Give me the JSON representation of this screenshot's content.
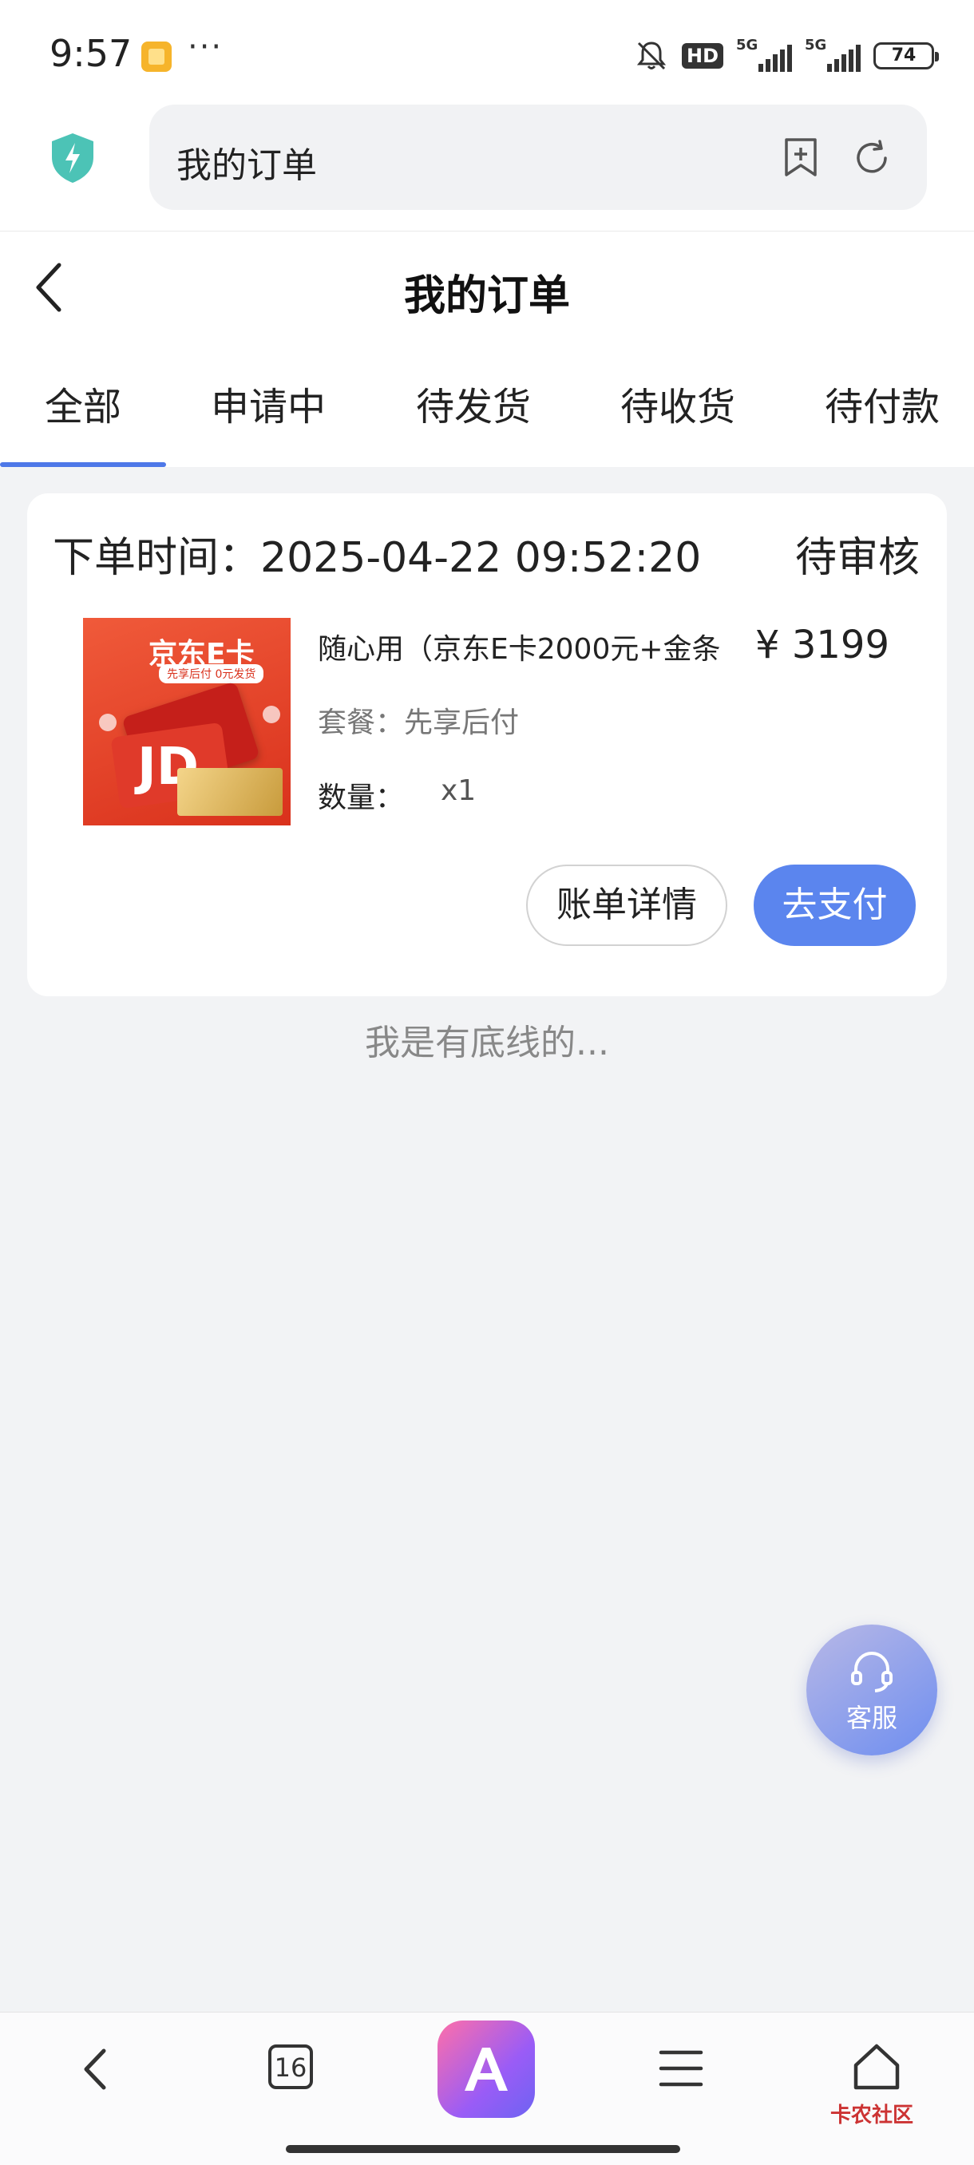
{
  "status_bar": {
    "time": "9:57",
    "more": "···",
    "hd": "HD",
    "network_1": "5G",
    "network_2": "5G",
    "battery": "74"
  },
  "browser": {
    "address_text": "我的订单"
  },
  "header": {
    "title": "我的订单"
  },
  "tabs": [
    {
      "label": "全部",
      "active": true
    },
    {
      "label": "申请中",
      "active": false
    },
    {
      "label": "待发货",
      "active": false
    },
    {
      "label": "待收货",
      "active": false
    },
    {
      "label": "待付款",
      "active": false
    }
  ],
  "order": {
    "time_label": "下单时间：2025-04-22 09:52:20",
    "status": "待审核",
    "product": {
      "image_brand": "京东E卡",
      "image_tag": "先享后付 0元发货",
      "image_logo": "JD",
      "name": "随心用（京东E卡2000元+金条",
      "price": "¥ 3199",
      "package_label": "套餐：先享后付",
      "qty_label": "数量：",
      "qty_value": "x1"
    },
    "detail_button": "账单详情",
    "pay_button": "去支付"
  },
  "footer_text": "我是有底线的...",
  "service": {
    "label": "客服"
  },
  "bottom_nav": {
    "tab_count": "16",
    "watermark": "卡农社区"
  },
  "colors": {
    "accent": "#5b85ee",
    "tab_indicator": "#4e78e8",
    "background": "#f2f3f5"
  }
}
